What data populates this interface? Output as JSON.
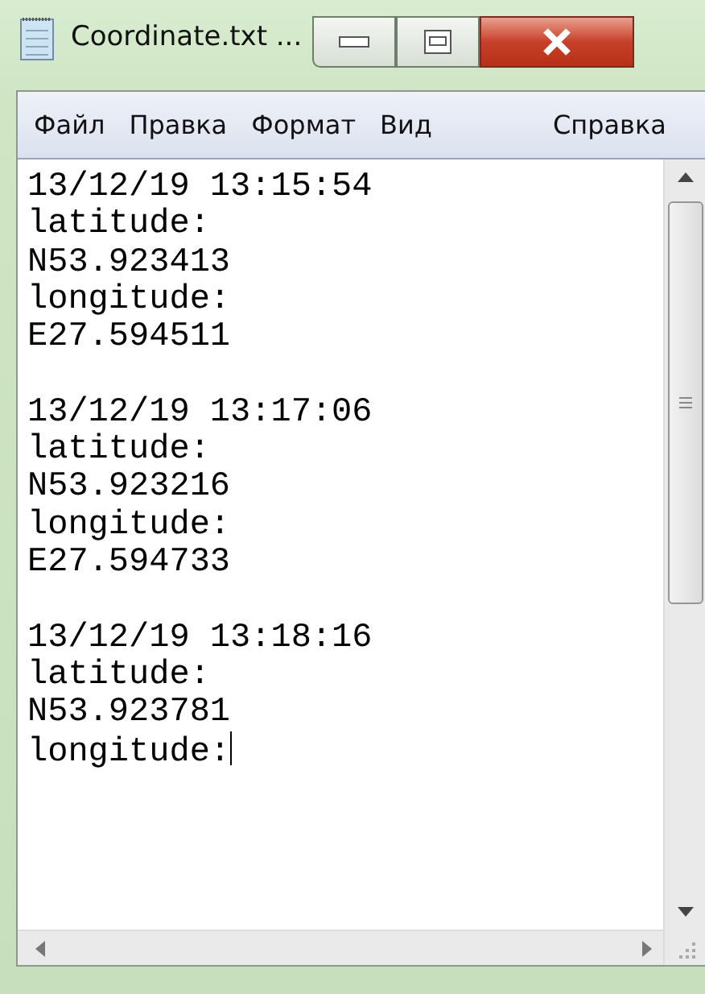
{
  "window": {
    "title": "Coordinate.txt ..."
  },
  "menu": [
    "Файл",
    "Правка",
    "Формат",
    "Вид",
    "Справка"
  ],
  "text_blocks": [
    {
      "lines": [
        "13/12/19 13:15:54",
        "latitude:",
        "N53.923413",
        "longitude:",
        "E27.594511"
      ]
    },
    {
      "lines": [
        "13/12/19 13:17:06",
        "latitude:",
        "N53.923216",
        "longitude:",
        "E27.594733"
      ]
    },
    {
      "lines": [
        "13/12/19 13:18:16",
        "latitude:",
        "N53.923781",
        "longitude:"
      ]
    }
  ]
}
